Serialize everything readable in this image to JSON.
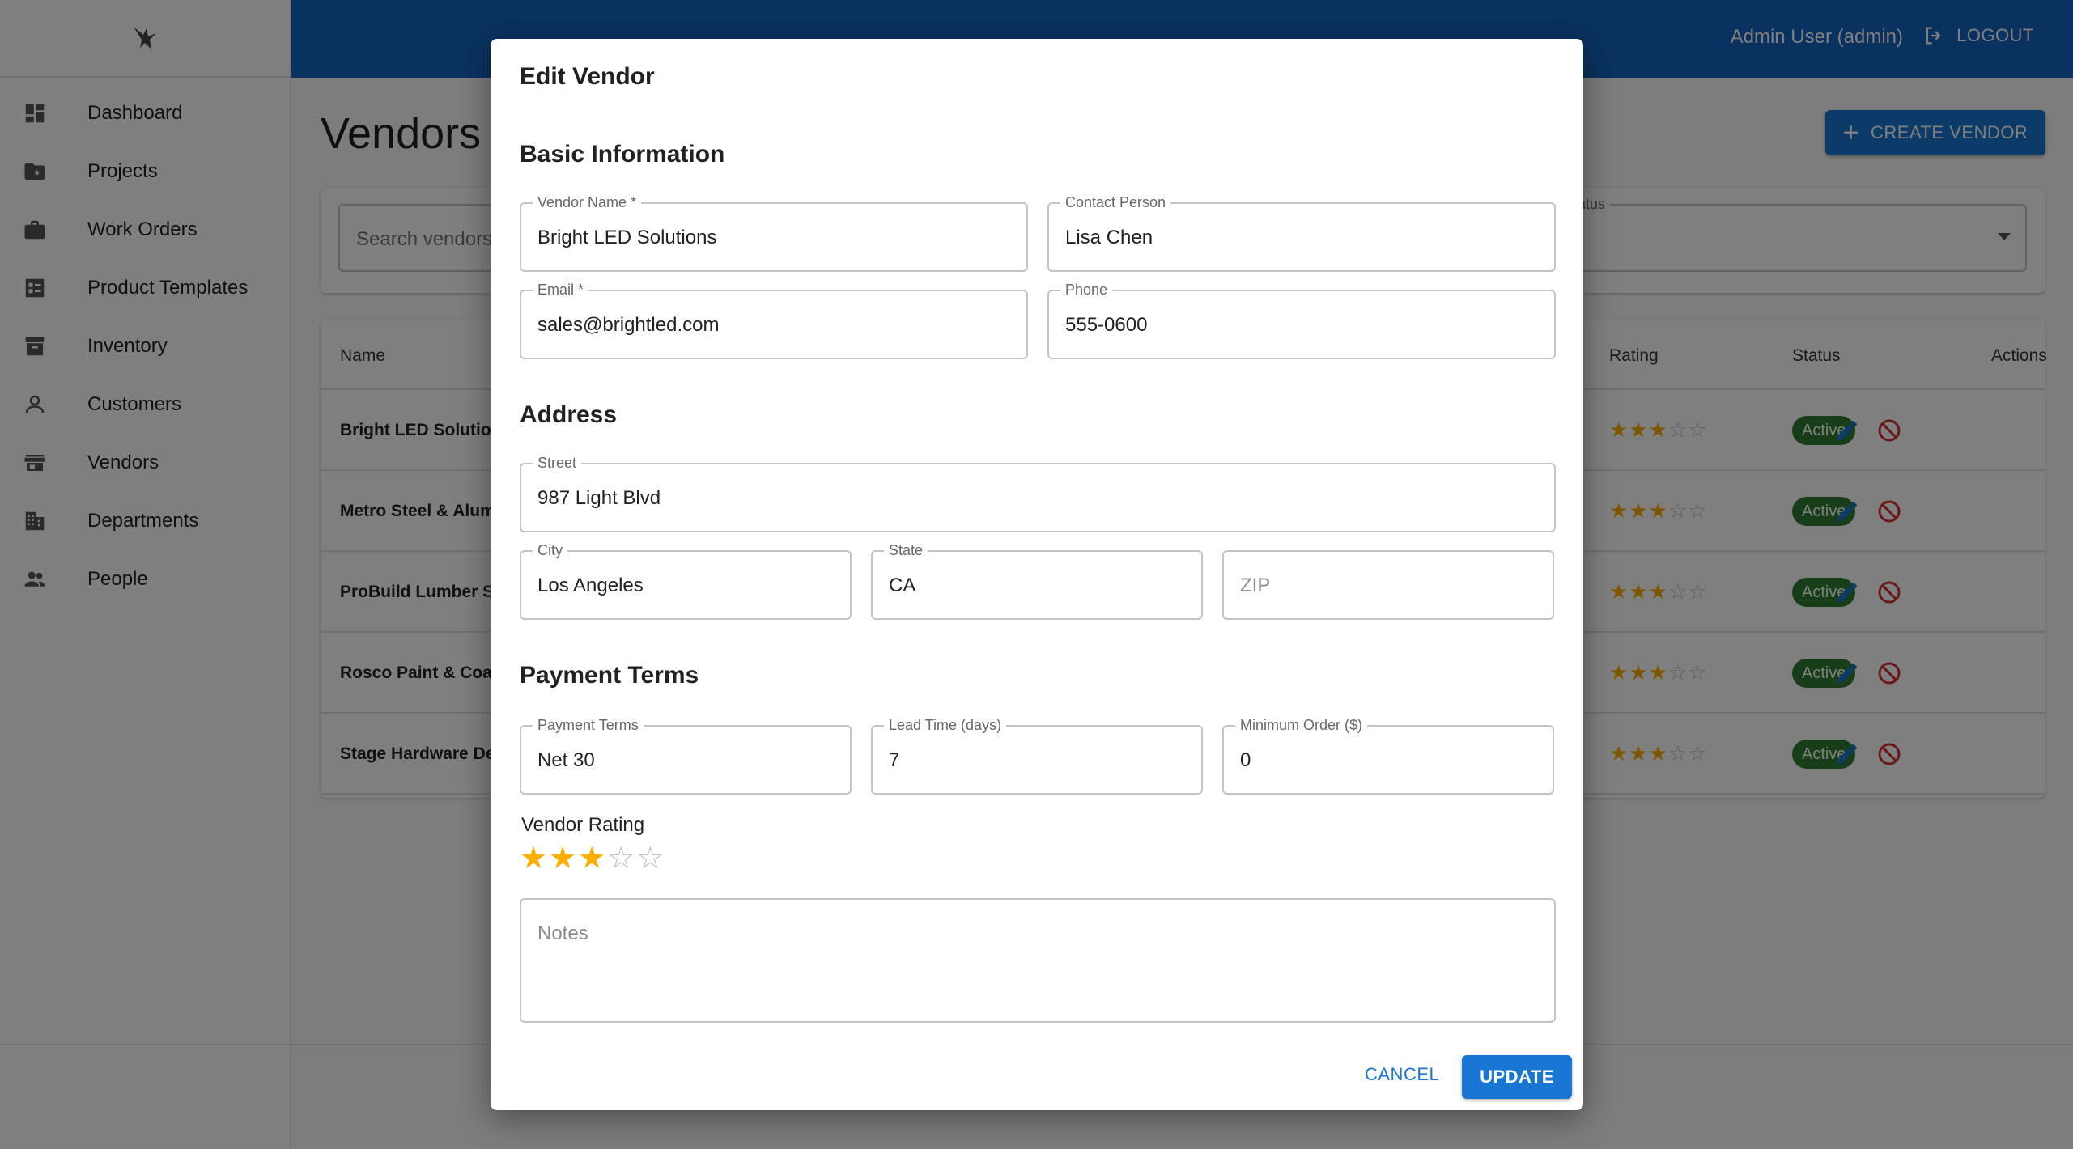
{
  "app": {
    "logo_icon": "hawk-logo-icon"
  },
  "sidebar": {
    "items": [
      {
        "label": "Dashboard",
        "icon": "dashboard-icon"
      },
      {
        "label": "Projects",
        "icon": "folder-star-icon"
      },
      {
        "label": "Work Orders",
        "icon": "briefcase-icon"
      },
      {
        "label": "Product Templates",
        "icon": "list-alt-icon"
      },
      {
        "label": "Inventory",
        "icon": "archive-box-icon"
      },
      {
        "label": "Customers",
        "icon": "person-icon"
      },
      {
        "label": "Vendors",
        "icon": "storefront-icon"
      },
      {
        "label": "Departments",
        "icon": "building-icon"
      },
      {
        "label": "People",
        "icon": "people-icon"
      }
    ]
  },
  "header": {
    "user": "Admin User (admin)",
    "logout_label": "LOGOUT"
  },
  "page": {
    "title": "Vendors",
    "create_button": "CREATE VENDOR",
    "search_placeholder": "Search vendors",
    "status_filter_label": "Status"
  },
  "table": {
    "columns": {
      "name": "Name",
      "rating": "Rating",
      "status": "Status",
      "actions": "Actions"
    },
    "rows": [
      {
        "name": "Bright LED Solutions",
        "rating": 3,
        "status": "Active"
      },
      {
        "name": "Metro Steel & Aluminum",
        "rating": 3,
        "status": "Active"
      },
      {
        "name": "ProBuild Lumber Supply",
        "rating": 3,
        "status": "Active"
      },
      {
        "name": "Rosco Paint & Coatings",
        "rating": 3,
        "status": "Active"
      },
      {
        "name": "Stage Hardware Depot",
        "rating": 3,
        "status": "Active"
      }
    ]
  },
  "dialog": {
    "title": "Edit Vendor",
    "sections": {
      "basic": "Basic Information",
      "address": "Address",
      "payment": "Payment Terms"
    },
    "fields": {
      "vendor_name": {
        "label": "Vendor Name *",
        "value": "Bright LED Solutions"
      },
      "contact_person": {
        "label": "Contact Person",
        "value": "Lisa Chen"
      },
      "email": {
        "label": "Email *",
        "value": "sales@brightled.com"
      },
      "phone": {
        "label": "Phone",
        "value": "555-0600"
      },
      "street": {
        "label": "Street",
        "value": "987 Light Blvd"
      },
      "city": {
        "label": "City",
        "value": "Los Angeles"
      },
      "state": {
        "label": "State",
        "value": "CA"
      },
      "zip": {
        "placeholder": "ZIP"
      },
      "payment_terms": {
        "label": "Payment Terms",
        "value": "Net 30"
      },
      "lead_time": {
        "label": "Lead Time (days)",
        "value": "7"
      },
      "minimum_order": {
        "label": "Minimum Order ($)",
        "value": "0"
      },
      "notes": {
        "placeholder": "Notes"
      }
    },
    "rating_label": "Vendor Rating",
    "rating_value": 3,
    "rating_max": 5,
    "cancel_label": "CANCEL",
    "update_label": "UPDATE"
  },
  "colors": {
    "primary": "#1976d2",
    "appbar": "#1565c0",
    "active_badge": "#2e7d32",
    "star": "#faaf00",
    "danger": "#d32f2f"
  }
}
